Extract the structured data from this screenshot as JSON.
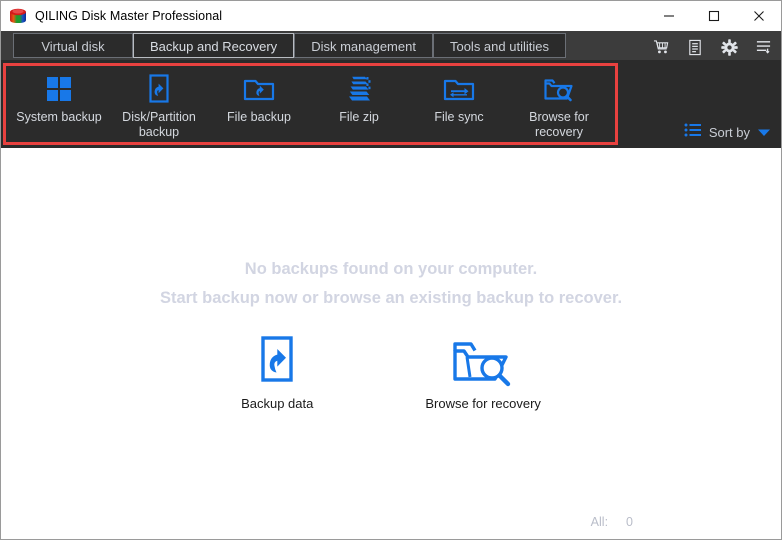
{
  "window": {
    "title": "QILING Disk Master Professional",
    "logo_icon": "qiling-cylinder-logo",
    "controls": {
      "minimize": "minimize-icon",
      "maximize": "maximize-icon",
      "close": "close-icon"
    }
  },
  "tabs": [
    {
      "label": "Virtual disk",
      "active": false
    },
    {
      "label": "Backup and Recovery",
      "active": true
    },
    {
      "label": "Disk management",
      "active": false
    },
    {
      "label": "Tools and utilities",
      "active": false
    }
  ],
  "tab_icons": [
    {
      "name": "shopping-cart-icon"
    },
    {
      "name": "document-list-icon"
    },
    {
      "name": "gear-icon"
    },
    {
      "name": "menu-lines-icon"
    }
  ],
  "toolbar": {
    "highlight_color": "#e8413f",
    "items": [
      {
        "label": "System backup",
        "icon": "windows-grid-icon"
      },
      {
        "label": "Disk/Partition\nbackup",
        "icon": "disk-arrow-icon"
      },
      {
        "label": "File backup",
        "icon": "folder-arrow-icon"
      },
      {
        "label": "File zip",
        "icon": "stacked-files-icon"
      },
      {
        "label": "File sync",
        "icon": "folder-sync-icon"
      },
      {
        "label": "Browse for\nrecovery",
        "icon": "folder-search-icon"
      }
    ],
    "sort_by": {
      "label": "Sort by",
      "icon": "bulleted-list-icon",
      "caret": "chevron-down-icon"
    }
  },
  "content": {
    "empty_message_line1": "No backups found on your computer.",
    "empty_message_line2": "Start backup now or browse an existing backup to recover.",
    "actions": [
      {
        "label": "Backup data",
        "icon": "disk-arrow-icon"
      },
      {
        "label": "Browse for recovery",
        "icon": "folder-search-icon"
      }
    ]
  },
  "statusbar": {
    "all_label": "All:",
    "all_value": "0"
  },
  "colors": {
    "accent_blue": "#1878e8",
    "toolbar_bg": "#2b2b2b",
    "tabstrip_bg": "#3c3c3c",
    "highlight_red": "#e8413f"
  }
}
